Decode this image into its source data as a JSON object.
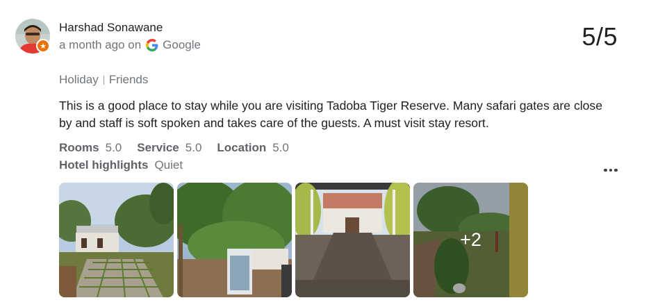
{
  "review": {
    "author": "Harshad Sonawane",
    "time": "a month ago on",
    "source": "Google",
    "score": "5/5",
    "trip_type": "Holiday",
    "trip_company": "Friends",
    "text": "This is a good place to stay while you are visiting Tadoba Tiger Reserve. Many safari gates are close by and staff is soft spoken and takes care of the guests. A must visit stay resort.",
    "ratings": [
      {
        "label": "Rooms",
        "value": "5.0"
      },
      {
        "label": "Service",
        "value": "5.0"
      },
      {
        "label": "Location",
        "value": "5.0"
      }
    ],
    "highlights_label": "Hotel highlights",
    "highlights_value": "Quiet",
    "photos_more_count": "+2",
    "colors": {
      "badge": "#e8710a",
      "muted_text": "#70757a",
      "label_text": "#5f6368"
    },
    "icons": {
      "avatar_badge": "local-guide-star-icon",
      "source": "google-g-icon",
      "menu": "more-vertical-dots-icon"
    }
  }
}
